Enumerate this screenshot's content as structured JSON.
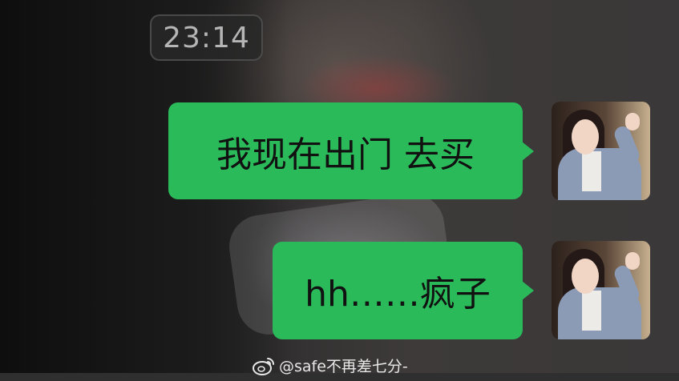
{
  "timestamp": "23:14",
  "messages": [
    {
      "text": "我现在出门 去买",
      "avatar_icon": "avatar-photo-icon"
    },
    {
      "text": "hh……疯子",
      "avatar_icon": "avatar-photo-icon"
    }
  ],
  "watermark": {
    "icon": "weibo-icon",
    "text": "@safe不再差七分-"
  },
  "colors": {
    "bubble": "#2aba5a",
    "timestamp_text": "#b5b5b5"
  }
}
